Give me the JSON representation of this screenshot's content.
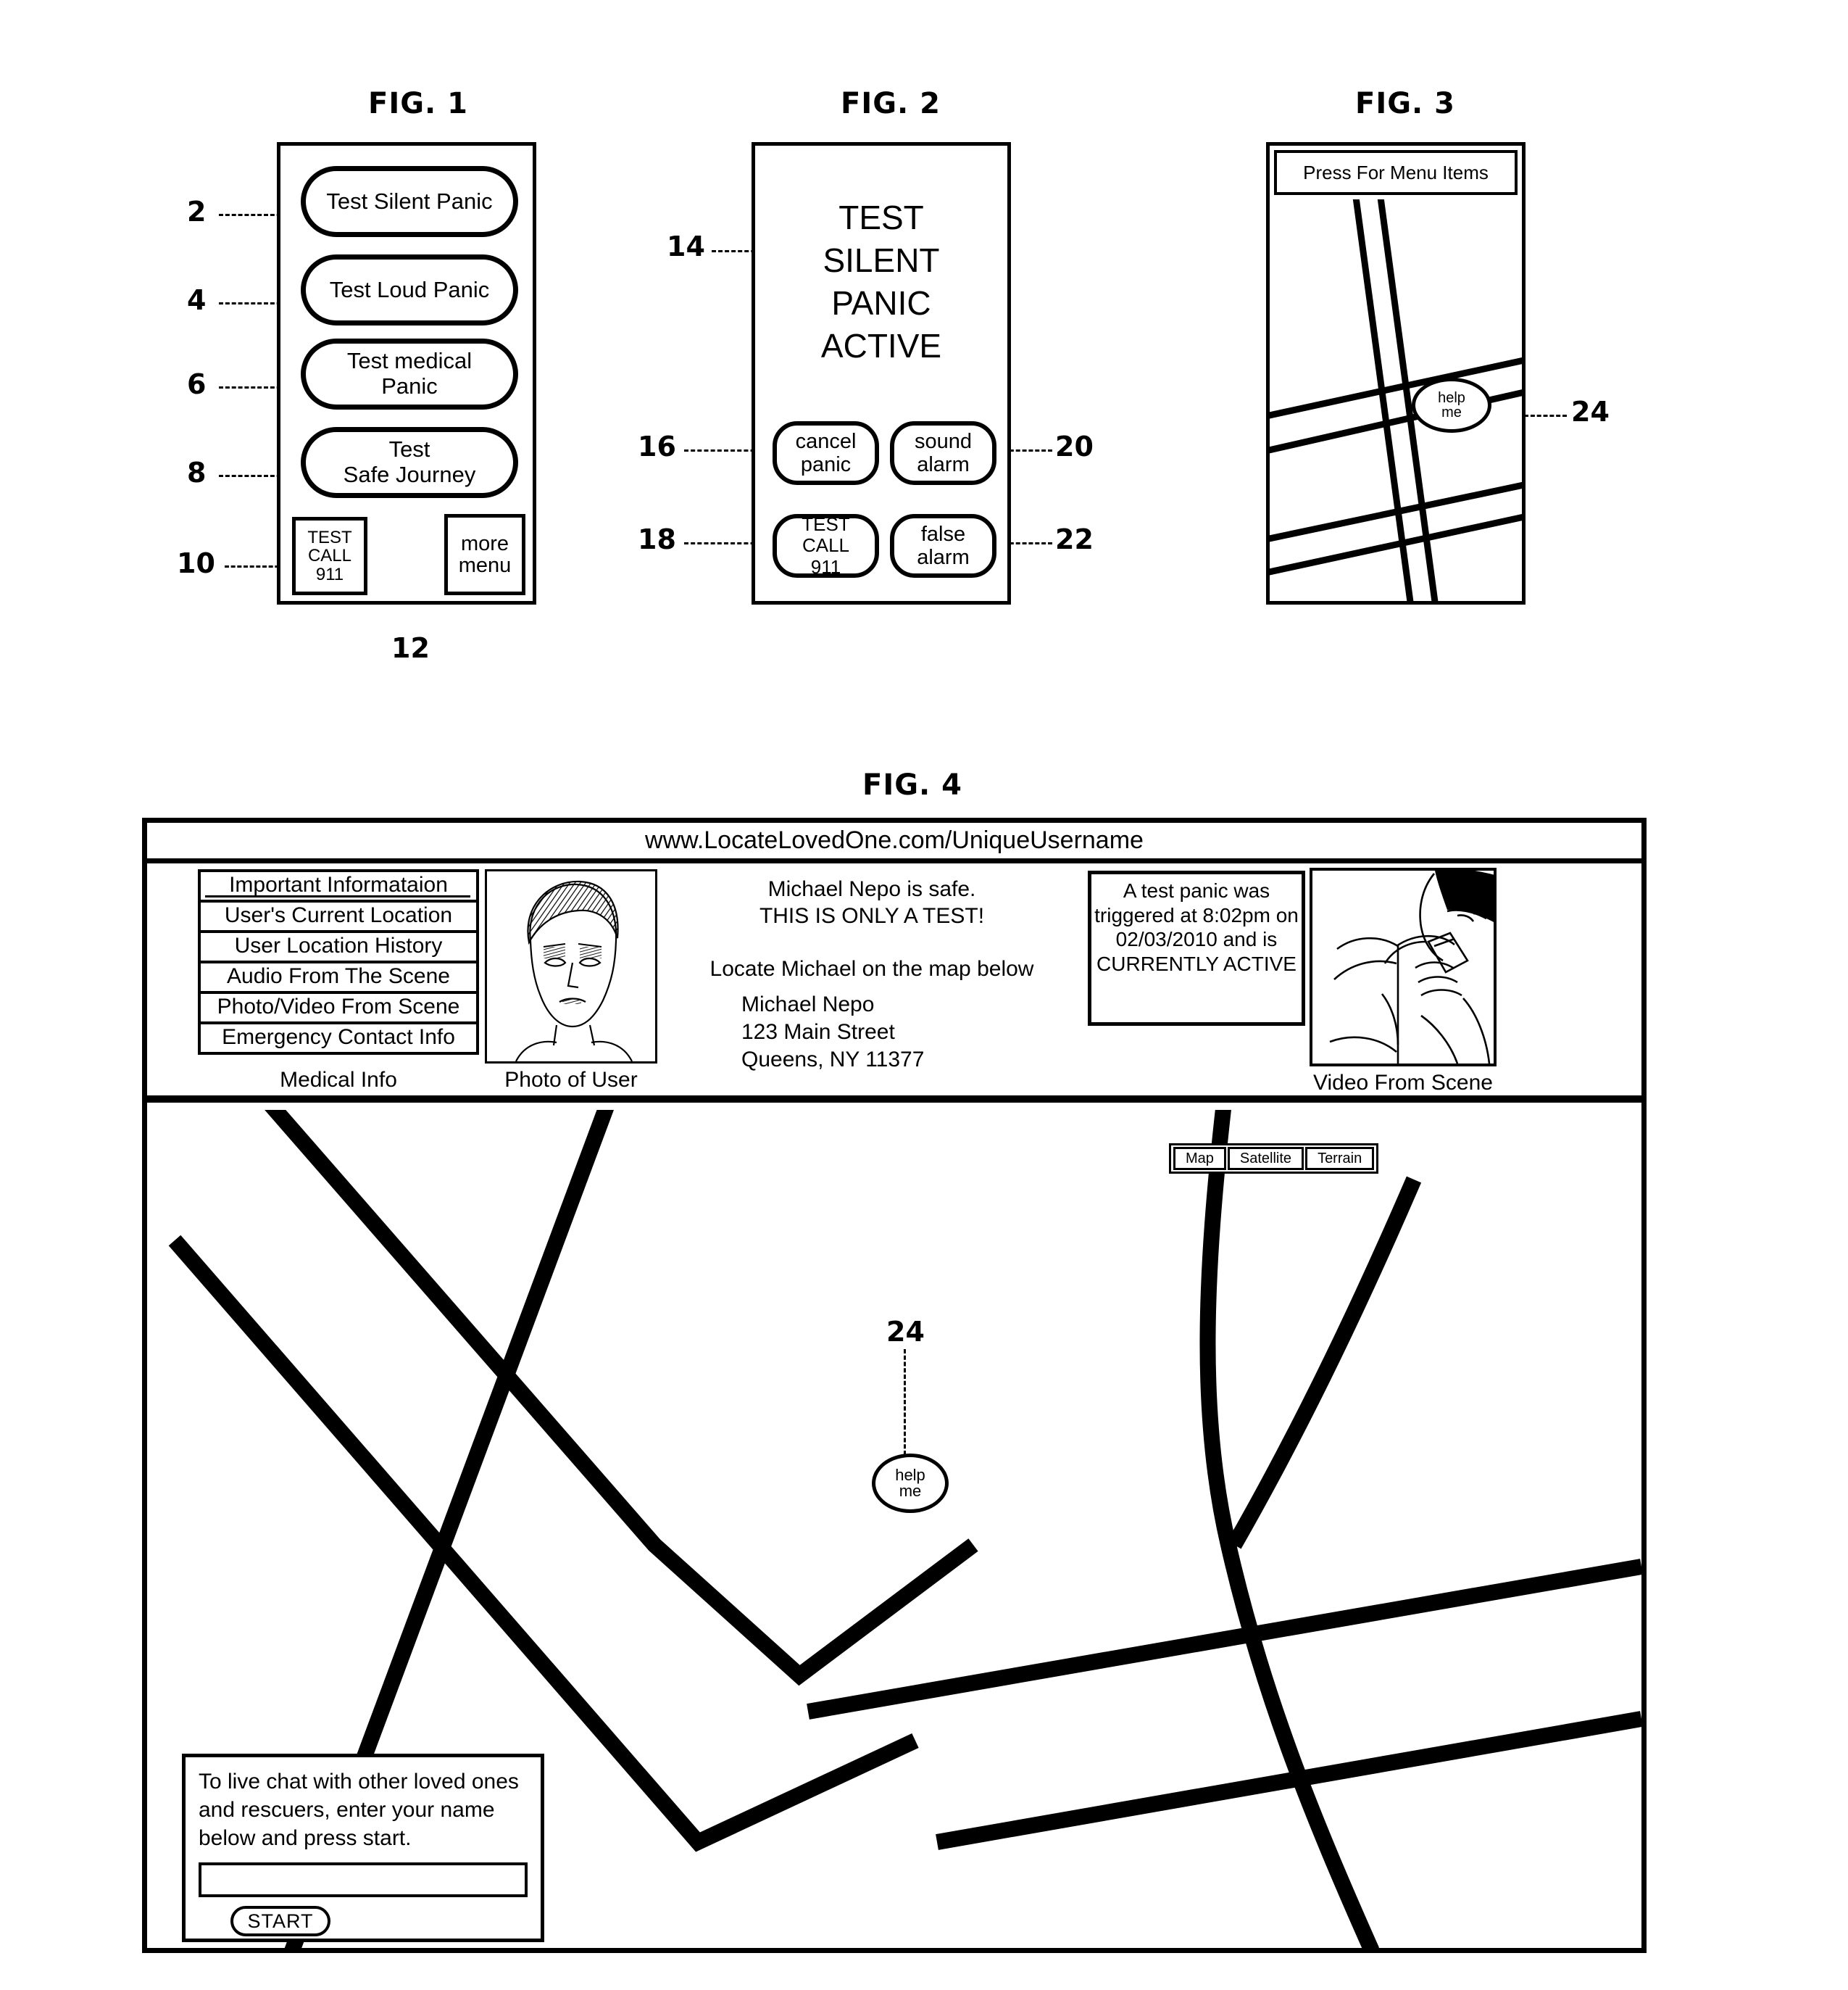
{
  "figures": {
    "fig1": {
      "title": "FIG. 1",
      "buttons": [
        {
          "ref": "2",
          "label": "Test Silent Panic"
        },
        {
          "ref": "4",
          "label": "Test Loud Panic"
        },
        {
          "ref": "6",
          "label": "Test medical\nPanic"
        },
        {
          "ref": "8",
          "label": "Test\nSafe Journey"
        }
      ],
      "bottom": {
        "call911": {
          "ref": "10",
          "label": "TEST\nCALL\n911"
        },
        "more_menu": {
          "ref": "12",
          "label": "more\nmenu"
        }
      }
    },
    "fig2": {
      "title": "FIG. 2",
      "status": {
        "ref": "14",
        "text": "TEST\nSILENT\nPANIC\nACTIVE"
      },
      "buttons": [
        {
          "ref": "16",
          "label": "cancel\npanic"
        },
        {
          "ref": "20",
          "label": "sound\nalarm"
        },
        {
          "ref": "18",
          "label": "TEST\nCALL\n911"
        },
        {
          "ref": "22",
          "label": "false\nalarm"
        }
      ]
    },
    "fig3": {
      "title": "FIG. 3",
      "menubar_label": "Press For Menu Items",
      "marker": {
        "ref": "24",
        "line1": "help",
        "line2": "me"
      }
    },
    "fig4": {
      "title": "FIG. 4",
      "url": "www.LocateLovedOne.com/UniqueUsername",
      "menu_items": [
        "Important Informataion",
        "User's Current Location",
        "User Location History",
        "Audio From The Scene",
        "Photo/Video From Scene",
        "Emergency Contact Info"
      ],
      "medical_info_label": "Medical Info",
      "photo_caption": "Photo of User",
      "video_caption": "Video From Scene",
      "center_message": "Michael Nepo is safe.\nTHIS IS ONLY A TEST!\n\nLocate Michael on the map below",
      "address": "Michael Nepo\n123 Main Street\nQueens, NY 11377",
      "alert_text": "A test panic was triggered at 8:02pm on 02/03/2010 and is CURRENTLY ACTIVE",
      "map_types": [
        "Map",
        "Satellite",
        "Terrain"
      ],
      "marker": {
        "ref": "24",
        "line1": "help",
        "line2": "me"
      },
      "chat": {
        "instructions": "To live chat with other loved ones and rescuers, enter your name below and press start.",
        "input_value": "",
        "start_label": "START"
      }
    }
  },
  "colors": {
    "ink": "#000000",
    "paper": "#ffffff"
  }
}
